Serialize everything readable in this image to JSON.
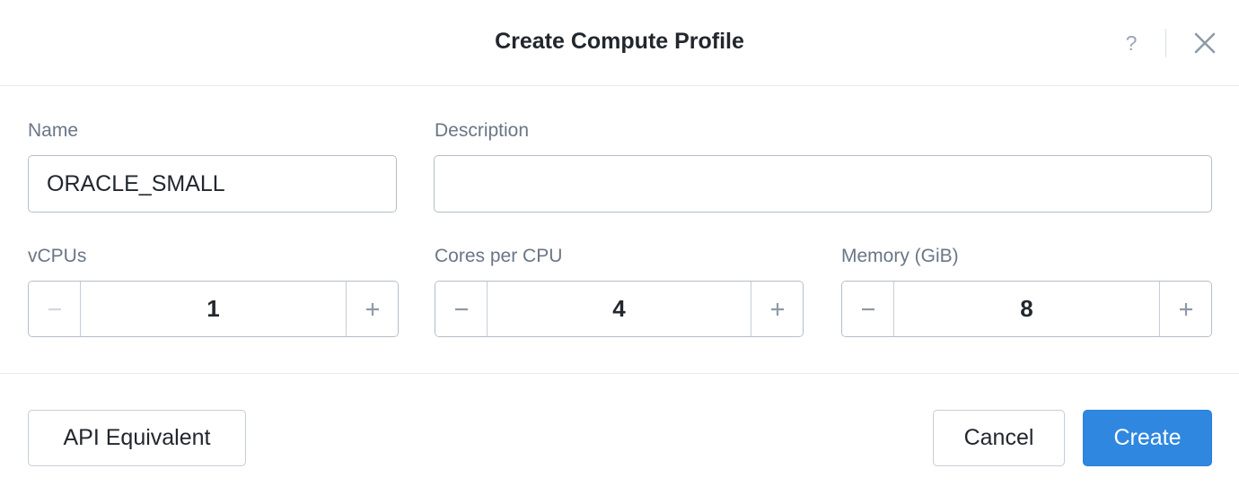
{
  "dialog": {
    "title": "Create Compute Profile",
    "help_icon": "question-mark-icon",
    "close_icon": "close-x-icon"
  },
  "form": {
    "name": {
      "label": "Name",
      "value": "ORACLE_SMALL"
    },
    "description": {
      "label": "Description",
      "value": ""
    },
    "vcpus": {
      "label": "vCPUs",
      "value": "1"
    },
    "cores_per_cpu": {
      "label": "Cores per CPU",
      "value": "4"
    },
    "memory": {
      "label": "Memory (GiB)",
      "value": "8"
    }
  },
  "footer": {
    "api_equivalent_label": "API Equivalent",
    "cancel_label": "Cancel",
    "create_label": "Create"
  },
  "colors": {
    "primary": "#2f87e0",
    "label_text": "#6a7686",
    "border": "#b5bdc8"
  }
}
